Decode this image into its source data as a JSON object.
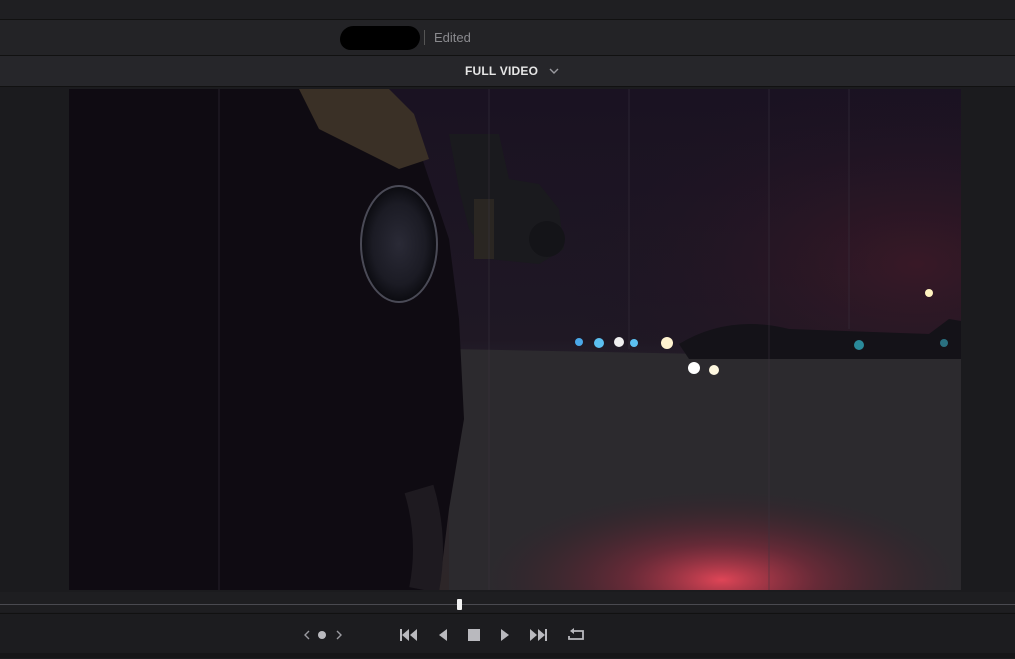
{
  "title_bar": {
    "status_text": "Edited"
  },
  "viewer_mode": {
    "selected": "FULL VIDEO"
  },
  "video": {
    "description_icon": "video-frame"
  },
  "timeline": {
    "playhead_fraction": 0.45
  },
  "transport": {
    "controls": [
      "clip-nav-prev-icon",
      "clip-nav-dot-icon",
      "clip-nav-next-icon",
      "skip-to-start-icon",
      "step-back-icon",
      "stop-icon",
      "play-icon",
      "skip-to-end-icon",
      "loop-icon"
    ]
  },
  "colors": {
    "background": "#1c1c1f",
    "bar": "#232326",
    "icon": "#b9b9be",
    "accent_text": "#e6e6e6"
  }
}
